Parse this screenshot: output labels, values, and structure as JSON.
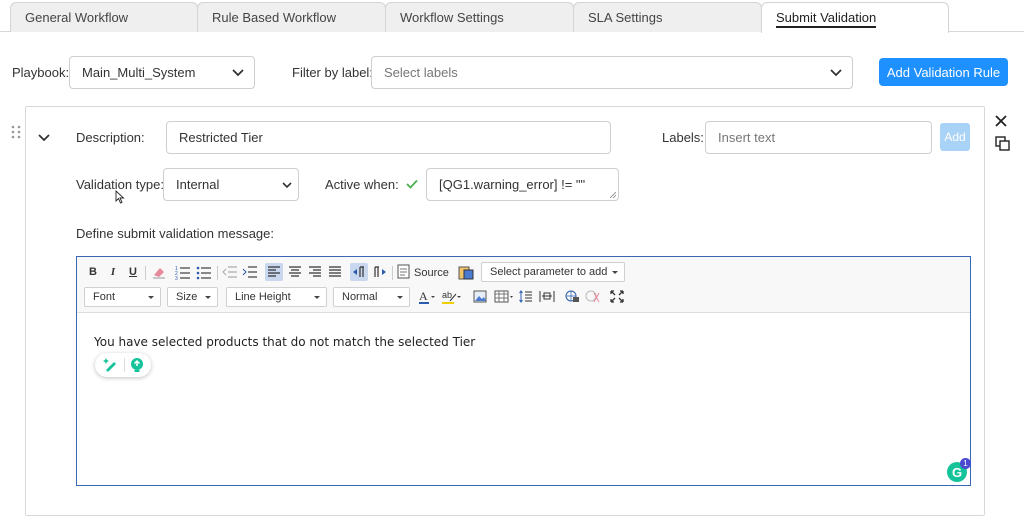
{
  "tabs": [
    {
      "label": "General Workflow"
    },
    {
      "label": "Rule Based Workflow"
    },
    {
      "label": "Workflow Settings"
    },
    {
      "label": "SLA Settings"
    },
    {
      "label": "Submit Validation"
    }
  ],
  "header": {
    "playbook_label": "Playbook:",
    "playbook_value": "Main_Multi_System",
    "filter_label": "Filter by label:",
    "filter_placeholder": "Select labels",
    "add_rule_label": "Add Validation Rule"
  },
  "rule": {
    "description_label": "Description:",
    "description_value": "Restricted Tier",
    "labels_label": "Labels:",
    "labels_placeholder": "Insert text",
    "add_label": "Add",
    "validation_type_label": "Validation type:",
    "validation_type_value": "Internal",
    "active_when_label": "Active when:",
    "active_when_value": "[QG1.warning_error] != \"\"",
    "message_label": "Define submit validation message:"
  },
  "editor": {
    "source_label": "Source",
    "param_select": "Select parameter to add",
    "font_combo": "Font",
    "size_combo": "Size",
    "line_height_combo": "Line Height",
    "format_combo": "Normal",
    "content": "You have selected products that do not match the selected Tier",
    "grammarly_count": "1"
  },
  "colors": {
    "accent": "#1e90ff",
    "check": "#4caf50",
    "grammarly": "#15c39a"
  }
}
